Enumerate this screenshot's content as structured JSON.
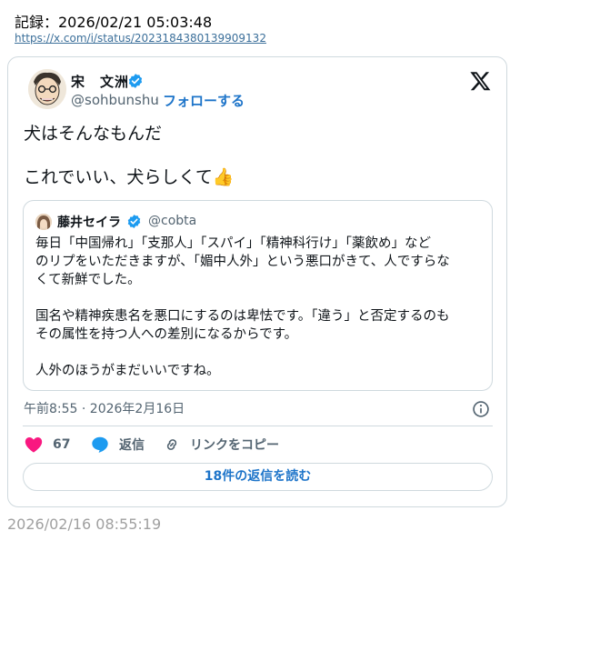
{
  "record": {
    "line": "記録：2026/02/21 05:03:48",
    "url": "https://x.com/i/status/2023184380139909132"
  },
  "tweet": {
    "author_name": "宋　文洲",
    "author_handle": "@sohbunshu",
    "separator": "·",
    "follow_label": "フォローする",
    "text_line1": "犬はそんなもんだ",
    "text_line2": "これでいい、犬らしくて",
    "emoji": "👍",
    "timestamp": "午前8:55 · 2026年2月16日"
  },
  "quote": {
    "author_name": "藤井セイラ",
    "author_handle": "@cobta",
    "lines": [
      "毎日「中国帰れ」「支那人」「スパイ」「精神科行け」「薬飲め」など",
      "のリプをいただきますが、「媚中人外」という悪口がきて、人ですらな",
      "くて新鮮でした。",
      "",
      "国名や精神疾患名を悪口にするのは卑怯です。「違う」と否定するのも",
      "その属性を持つ人への差別になるからです。",
      "",
      "人外のほうがまだいいですね。"
    ]
  },
  "actions": {
    "like_count": "67",
    "reply_label": "返信",
    "copy_label": "リンクをコピー"
  },
  "read_replies_label": "18件の返信を読む",
  "footer_date": "2026/02/16 08:55:19",
  "colors": {
    "link": "#1d74c9",
    "verified": "#1d9bf0",
    "like": "#f91880",
    "reply": "#1d9bf0",
    "muted": "#536471",
    "border": "#cfd9de"
  },
  "icons": [
    "verified-badge-icon",
    "x-logo-icon",
    "heart-icon",
    "reply-bubble-icon",
    "link-icon",
    "info-icon"
  ]
}
